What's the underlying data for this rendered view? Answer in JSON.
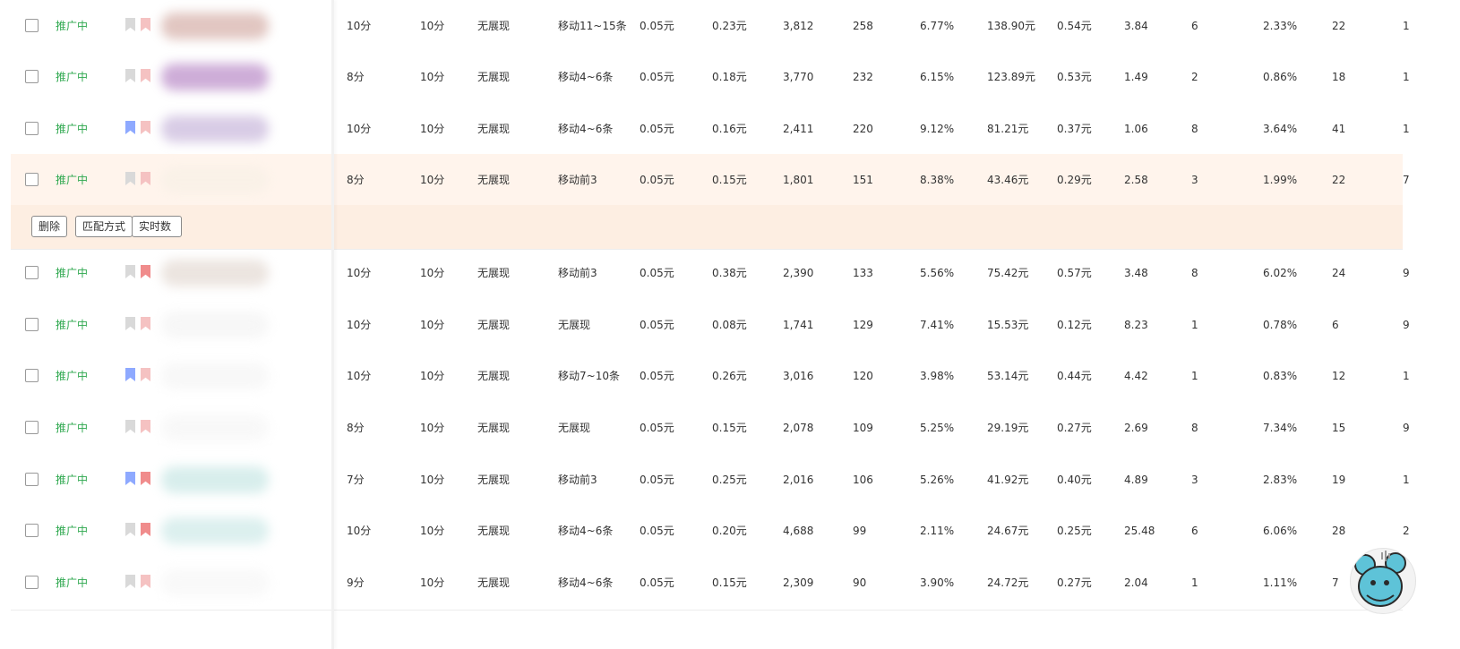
{
  "actions": {
    "delete_label": "删除",
    "match_label": "匹配方式",
    "realtime_label": "实时数据"
  },
  "rows": [
    {
      "status": "推广中",
      "flag1": "grey",
      "flag2": "pinklight",
      "c1": "10分",
      "c2": "10分",
      "c3": "无展现",
      "c4": "移动11~15条",
      "c5": "0.05元",
      "c6": "0.23元",
      "c7": "3,812",
      "c8": "258",
      "c9": "6.77%",
      "c10": "138.90元",
      "c11": "0.54元",
      "c12": "3.84",
      "c13": "6",
      "c14": "2.33%",
      "c15": "22",
      "c16": "1",
      "blur": "#c9988f"
    },
    {
      "status": "推广中",
      "flag1": "grey",
      "flag2": "pinklight",
      "c1": "8分",
      "c2": "10分",
      "c3": "无展现",
      "c4": "移动4~6条",
      "c5": "0.05元",
      "c6": "0.18元",
      "c7": "3,770",
      "c8": "232",
      "c9": "6.15%",
      "c10": "123.89元",
      "c11": "0.53元",
      "c12": "1.49",
      "c13": "2",
      "c14": "0.86%",
      "c15": "18",
      "c16": "1",
      "blur": "#a66ab8"
    },
    {
      "status": "推广中",
      "flag1": "blue",
      "flag2": "pinklight",
      "c1": "10分",
      "c2": "10分",
      "c3": "无展现",
      "c4": "移动4~6条",
      "c5": "0.05元",
      "c6": "0.16元",
      "c7": "2,411",
      "c8": "220",
      "c9": "9.12%",
      "c10": "81.21元",
      "c11": "0.37元",
      "c12": "1.06",
      "c13": "8",
      "c14": "3.64%",
      "c15": "41",
      "c16": "1",
      "blur": "#b9a3d1"
    },
    {
      "status": "推广中",
      "flag1": "grey",
      "flag2": "pinklight",
      "c1": "8分",
      "c2": "10分",
      "c3": "无展现",
      "c4": "移动前3",
      "c5": "0.05元",
      "c6": "0.15元",
      "c7": "1,801",
      "c8": "151",
      "c9": "8.38%",
      "c10": "43.46元",
      "c11": "0.29元",
      "c12": "2.58",
      "c13": "3",
      "c14": "1.99%",
      "c15": "22",
      "c16": "7",
      "blur": "#f5efe4"
    },
    {
      "status": "推广中",
      "flag1": "grey",
      "flag2": "pink",
      "c1": "10分",
      "c2": "10分",
      "c3": "无展现",
      "c4": "移动前3",
      "c5": "0.05元",
      "c6": "0.38元",
      "c7": "2,390",
      "c8": "133",
      "c9": "5.56%",
      "c10": "75.42元",
      "c11": "0.57元",
      "c12": "3.48",
      "c13": "8",
      "c14": "6.02%",
      "c15": "24",
      "c16": "9",
      "blur": "#dccfc6"
    },
    {
      "status": "推广中",
      "flag1": "grey",
      "flag2": "pinklight",
      "c1": "10分",
      "c2": "10分",
      "c3": "无展现",
      "c4": "无展现",
      "c5": "0.05元",
      "c6": "0.08元",
      "c7": "1,741",
      "c8": "129",
      "c9": "7.41%",
      "c10": "15.53元",
      "c11": "0.12元",
      "c12": "8.23",
      "c13": "1",
      "c14": "0.78%",
      "c15": "6",
      "c16": "9",
      "blur": "#f0f0f0"
    },
    {
      "status": "推广中",
      "flag1": "blue",
      "flag2": "pinklight",
      "c1": "10分",
      "c2": "10分",
      "c3": "无展现",
      "c4": "移动7~10条",
      "c5": "0.05元",
      "c6": "0.26元",
      "c7": "3,016",
      "c8": "120",
      "c9": "3.98%",
      "c10": "53.14元",
      "c11": "0.44元",
      "c12": "4.42",
      "c13": "1",
      "c14": "0.83%",
      "c15": "12",
      "c16": "1",
      "blur": "#f2f2f2"
    },
    {
      "status": "推广中",
      "flag1": "grey",
      "flag2": "pinklight",
      "c1": "8分",
      "c2": "10分",
      "c3": "无展现",
      "c4": "无展现",
      "c5": "0.05元",
      "c6": "0.15元",
      "c7": "2,078",
      "c8": "109",
      "c9": "5.25%",
      "c10": "29.19元",
      "c11": "0.27元",
      "c12": "2.69",
      "c13": "8",
      "c14": "7.34%",
      "c15": "15",
      "c16": "9",
      "blur": "#f3f3f3"
    },
    {
      "status": "推广中",
      "flag1": "blue",
      "flag2": "pink",
      "c1": "7分",
      "c2": "10分",
      "c3": "无展现",
      "c4": "移动前3",
      "c5": "0.05元",
      "c6": "0.25元",
      "c7": "2,016",
      "c8": "106",
      "c9": "5.26%",
      "c10": "41.92元",
      "c11": "0.40元",
      "c12": "4.89",
      "c13": "3",
      "c14": "2.83%",
      "c15": "19",
      "c16": "1",
      "blur": "#b8e0dd"
    },
    {
      "status": "推广中",
      "flag1": "grey",
      "flag2": "pink",
      "c1": "10分",
      "c2": "10分",
      "c3": "无展现",
      "c4": "移动4~6条",
      "c5": "0.05元",
      "c6": "0.20元",
      "c7": "4,688",
      "c8": "99",
      "c9": "2.11%",
      "c10": "24.67元",
      "c11": "0.25元",
      "c12": "25.48",
      "c13": "6",
      "c14": "6.06%",
      "c15": "28",
      "c16": "2",
      "blur": "#bfe3e1"
    },
    {
      "status": "推广中",
      "flag1": "grey",
      "flag2": "pinklight",
      "c1": "9分",
      "c2": "10分",
      "c3": "无展现",
      "c4": "移动4~6条",
      "c5": "0.05元",
      "c6": "0.15元",
      "c7": "2,309",
      "c8": "90",
      "c9": "3.90%",
      "c10": "24.72元",
      "c11": "0.27元",
      "c12": "2.04",
      "c13": "1",
      "c14": "1.11%",
      "c15": "7",
      "c16": "",
      "blur": "#f4f4f4"
    }
  ]
}
